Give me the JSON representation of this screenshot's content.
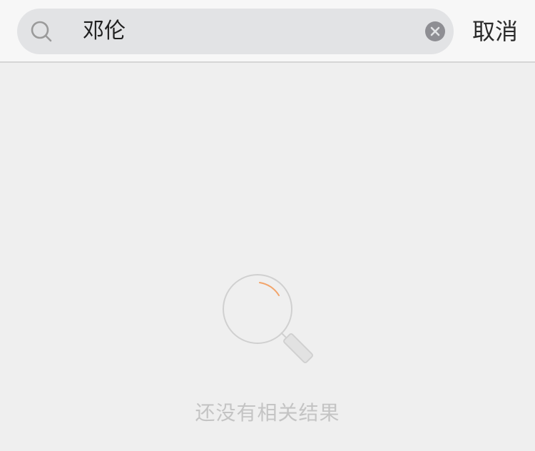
{
  "search": {
    "value": "邓伦",
    "cancel_label": "取消"
  },
  "empty_state": {
    "message": "还没有相关结果"
  },
  "colors": {
    "accent_arc": "#f2a46a",
    "background": "#efefef",
    "field_bg": "#e2e3e5"
  },
  "icons": {
    "search": "search-icon",
    "clear": "clear-icon",
    "empty": "magnifier-illustration"
  }
}
